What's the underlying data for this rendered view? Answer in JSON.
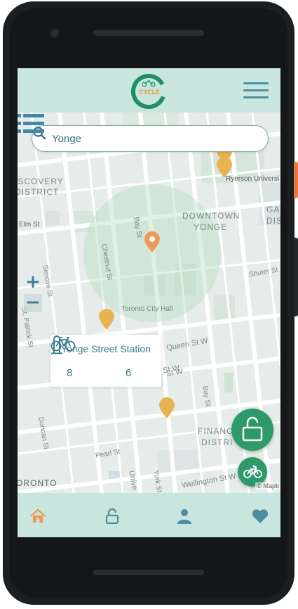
{
  "app": {
    "logo_text": "CYCLE",
    "brand_colors": {
      "primary": "#2e9a6a",
      "accent": "#e8a33d",
      "header": "#c8e6de"
    }
  },
  "search": {
    "value": "Yonge",
    "icon": "search-icon"
  },
  "map": {
    "labels": {
      "discovery_1": "ISCOVERY",
      "discovery_2": "DISTRICT",
      "downtown_1": "DOWNTOWN",
      "downtown_2": "YONGE",
      "ryerson": "Ryerson Universi",
      "elm": "Elm St",
      "bay_top": "Bay St",
      "chestnut": "Chestnut St",
      "simcoe": "Simcoe St",
      "st_patrick": "St. Patrick St",
      "city_hall": "Toronto City Hall",
      "queen": "Queen St W",
      "richmond": "Richmond St W",
      "adelaide": "St W",
      "bay_bottom": "Bay St",
      "duncan": "Duncan St",
      "pearl": "Pearl St",
      "york": "York St",
      "university": "Unive",
      "wellington": "Wellington St W",
      "financial_1": "FINANC",
      "financial_2": "DISTRI",
      "shuter": "Shuter St",
      "garden_1": "GA",
      "garden_2": "DIS",
      "toronto": "ORONTO",
      "attribution": "© Mapb"
    },
    "zoom_in": "+",
    "zoom_out": "−"
  },
  "station_popup": {
    "name": "Yonge Street Station",
    "bikes": "8",
    "docks": "6"
  },
  "tabs": [
    {
      "name": "home",
      "icon": "home-icon",
      "active": true
    },
    {
      "name": "unlock",
      "icon": "unlock-icon",
      "active": false
    },
    {
      "name": "profile",
      "icon": "user-icon",
      "active": false
    },
    {
      "name": "favorites",
      "icon": "heart-icon",
      "active": false
    }
  ]
}
